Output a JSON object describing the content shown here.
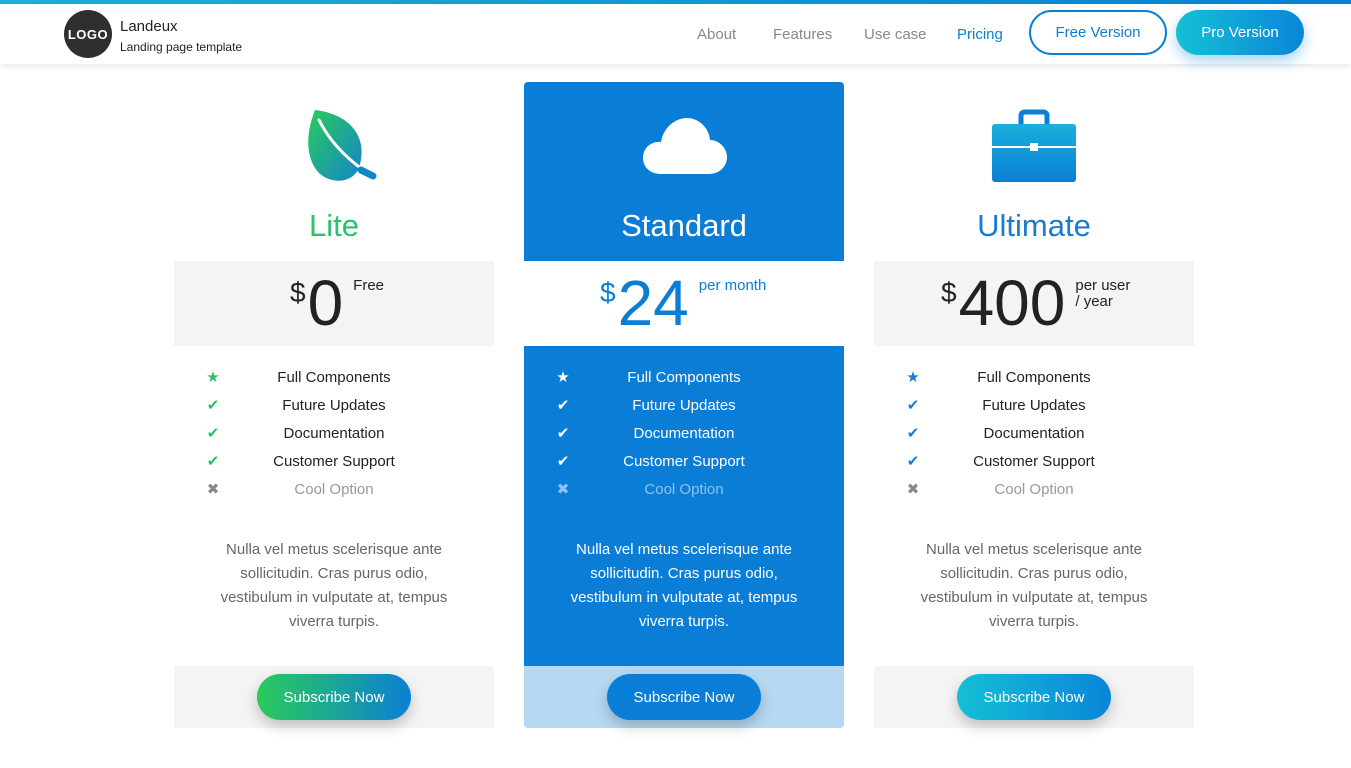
{
  "header": {
    "logo_text": "LOGO",
    "brand_name": "Landeux",
    "brand_tagline": "Landing page template",
    "nav": {
      "about": "About",
      "features": "Features",
      "use_case": "Use case",
      "pricing": "Pricing"
    },
    "free_button": "Free Version",
    "pro_button": "Pro Version"
  },
  "colors": {
    "accent": "#0a7dd6",
    "lite_green": "#2bc36a",
    "ultimate_blue": "#1a7bd0",
    "nav_active": "#0b7fd4"
  },
  "plans": {
    "lite": {
      "icon": "leaf-icon",
      "name": "Lite",
      "currency": "$",
      "amount": "0",
      "note": "Free",
      "features": {
        "f1": {
          "icon": "star-icon",
          "label": "Full Components"
        },
        "f2": {
          "icon": "check-icon",
          "label": "Future Updates"
        },
        "f3": {
          "icon": "check-icon",
          "label": "Documentation"
        },
        "f4": {
          "icon": "check-icon",
          "label": "Customer Support"
        },
        "f5": {
          "icon": "cross-icon",
          "label": "Cool Option"
        }
      },
      "description": "Nulla vel metus scelerisque ante sollicitudin. Cras purus odio, vestibulum in vulputate at, tempus viverra turpis.",
      "cta": "Subscribe Now"
    },
    "standard": {
      "icon": "cloud-icon",
      "name": "Standard",
      "currency": "$",
      "amount": "24",
      "note": "per month",
      "features": {
        "f1": {
          "icon": "star-icon",
          "label": "Full Components"
        },
        "f2": {
          "icon": "check-icon",
          "label": "Future Updates"
        },
        "f3": {
          "icon": "check-icon",
          "label": "Documentation"
        },
        "f4": {
          "icon": "check-icon",
          "label": "Customer Support"
        },
        "f5": {
          "icon": "cross-icon",
          "label": "Cool Option"
        }
      },
      "description": "Nulla vel metus scelerisque ante sollicitudin. Cras purus odio, vestibulum in vulputate at, tempus viverra turpis.",
      "cta": "Subscribe Now"
    },
    "ultimate": {
      "icon": "briefcase-icon",
      "name": "Ultimate",
      "currency": "$",
      "amount": "400",
      "note_line1": "per user",
      "note_line2": "/ year",
      "features": {
        "f1": {
          "icon": "star-icon",
          "label": "Full Components"
        },
        "f2": {
          "icon": "check-icon",
          "label": "Future Updates"
        },
        "f3": {
          "icon": "check-icon",
          "label": "Documentation"
        },
        "f4": {
          "icon": "check-icon",
          "label": "Customer Support"
        },
        "f5": {
          "icon": "cross-icon",
          "label": "Cool Option"
        }
      },
      "description": "Nulla vel metus scelerisque ante sollicitudin. Cras purus odio, vestibulum in vulputate at, tempus viverra turpis.",
      "cta": "Subscribe Now"
    }
  }
}
